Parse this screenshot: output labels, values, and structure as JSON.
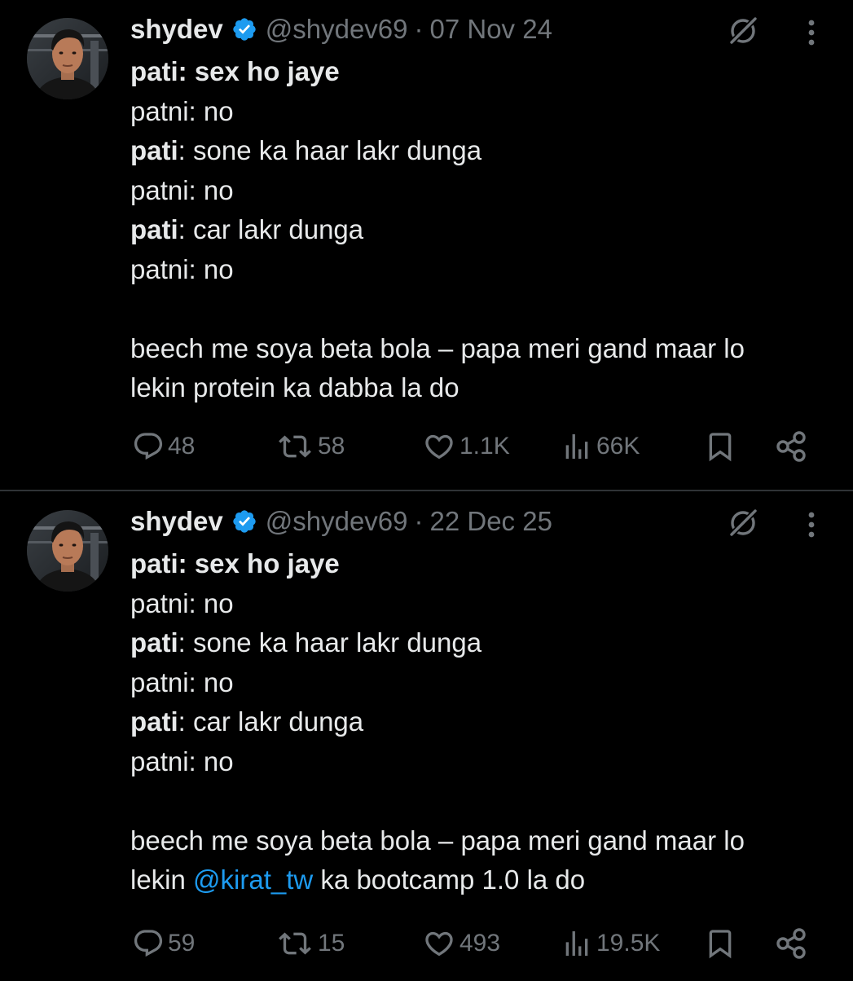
{
  "colors": {
    "background": "#000000",
    "text": "#e7e9ea",
    "muted": "#71767b",
    "mention": "#1d9bf0",
    "verified": "#1d9bf0",
    "divider": "#2f3336"
  },
  "tweets": [
    {
      "author": {
        "name": "shydev",
        "handle": "@shydev69",
        "verified_icon": "verified-badge-icon"
      },
      "separator": "·",
      "date": "07 Nov 24",
      "body": {
        "line1_bold": "pati: sex ho jaye",
        "line2": "patni: no",
        "line3_bold": "pati",
        "line3_rest": ": sone ka haar lakr dunga",
        "line4": "patni: no",
        "line5_bold": "pati",
        "line5_rest": ": car lakr dunga",
        "line6": "patni: no",
        "line8": "beech me soya beta bola – papa meri gand maar lo",
        "line9": "lekin protein ka dabba la do"
      },
      "stats": {
        "replies": "48",
        "reposts": "58",
        "likes": "1.1K",
        "views": "66K"
      }
    },
    {
      "author": {
        "name": "shydev",
        "handle": "@shydev69",
        "verified_icon": "verified-badge-icon"
      },
      "separator": "·",
      "date": "22 Dec 25",
      "body": {
        "line1_bold": "pati: sex ho jaye",
        "line2": "patni: no",
        "line3_bold": "pati",
        "line3_rest": ": sone ka haar lakr dunga",
        "line4": "patni: no",
        "line5_bold": "pati",
        "line5_rest": ": car lakr dunga",
        "line6": "patni: no",
        "line8": "beech me soya beta bola – papa meri gand maar lo",
        "line9_pre": "lekin ",
        "line9_mention": "@kirat_tw",
        "line9_post": " ka bootcamp 1.0 la do"
      },
      "stats": {
        "replies": "59",
        "reposts": "15",
        "likes": "493",
        "views": "19.5K"
      }
    }
  ]
}
